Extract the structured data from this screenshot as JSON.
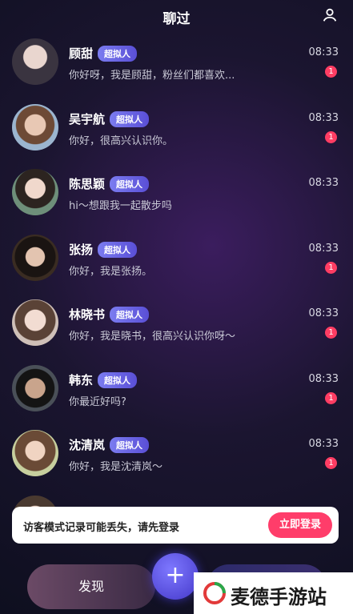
{
  "header": {
    "title": "聊过",
    "profile_icon": "person-outline-icon"
  },
  "badge_label": "超拟人",
  "conversations": [
    {
      "name": "顾甜",
      "badge": "超拟人",
      "message": "你好呀，我是顾甜，粉丝们都喜欢...",
      "time": "08:33",
      "unread": "1"
    },
    {
      "name": "吴宇航",
      "badge": "超拟人",
      "message": "你好，很高兴认识你。",
      "time": "08:33",
      "unread": "1"
    },
    {
      "name": "陈思颖",
      "badge": "超拟人",
      "message": "hi～想跟我一起散步吗",
      "time": "08:33",
      "unread": ""
    },
    {
      "name": "张扬",
      "badge": "超拟人",
      "message": "你好，我是张扬。",
      "time": "08:33",
      "unread": "1"
    },
    {
      "name": "林晓书",
      "badge": "超拟人",
      "message": "你好，我是晓书，很高兴认识你呀～",
      "time": "08:33",
      "unread": "1"
    },
    {
      "name": "韩东",
      "badge": "超拟人",
      "message": "你最近好吗?",
      "time": "08:33",
      "unread": "1"
    },
    {
      "name": "沈清岚",
      "badge": "超拟人",
      "message": "你好，我是沈清岚～",
      "time": "08:33",
      "unread": "1"
    }
  ],
  "banner": {
    "text": "访客模式记录可能丢失，请先登录",
    "button": "立即登录"
  },
  "bottom_nav": {
    "left_tab": "发现",
    "fab_icon": "plus-icon"
  },
  "watermark": {
    "text": "麦德手游站",
    "logo_icon": "brand-logo-icon"
  },
  "colors": {
    "accent_pink": "#ff3d6a",
    "badge_purple": "#6f6be6",
    "unread_red": "#ff3d63"
  }
}
